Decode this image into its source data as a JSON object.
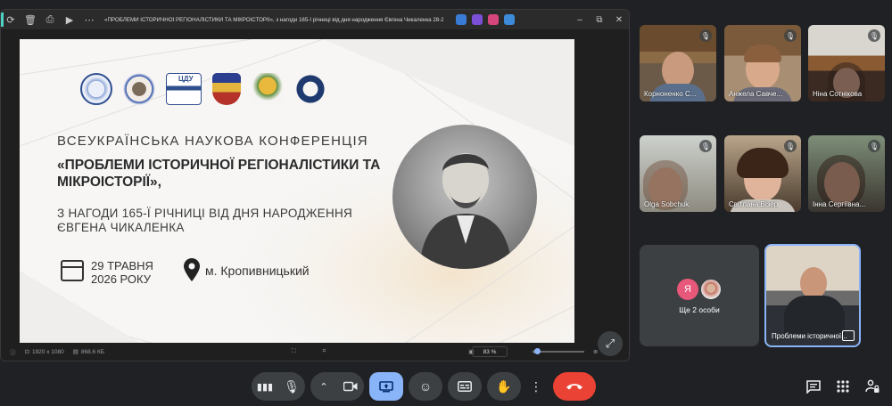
{
  "viewer": {
    "title": "«ПРОБЛЕМИ ІСТОРИЧНОЇ РЕГІОНАЛІСТИКИ ТА МІКРОІСТОРІЇ», з нагоди 165-ї річниці від дня народження Євгена Чикаленка 28-29 трав...",
    "status_dimensions": "1920 x 1080",
    "status_size": "868.6 КБ",
    "zoom": "83 %"
  },
  "slide": {
    "logo_label": "ЦДУ",
    "heading": "ВСЕУКРАЇНСЬКА НАУКОВА КОНФЕРЕНЦІЯ",
    "title": "«ПРОБЛЕМИ ІСТОРИЧНОЇ РЕГІОНАЛІСТИКИ ТА МІКРОІСТОРІЇ»,",
    "subtitle": "З НАГОДИ 165-Ї РІЧНИЦІ ВІД ДНЯ НАРОДЖЕННЯ ЄВГЕНА ЧИКАЛЕНКА",
    "date_line1": "29 ТРАВНЯ",
    "date_line2": "2026 РОКУ",
    "city": "м. Кропивницький"
  },
  "participants": [
    {
      "name": "Корноненко С..."
    },
    {
      "name": "Анжела Савче..."
    },
    {
      "name": "Ніна Сотнікова"
    },
    {
      "name": "Olga Sobchuk"
    },
    {
      "name": "Світлана Візер"
    },
    {
      "name": "Інна Сергіївна..."
    }
  ],
  "more_tile": {
    "avatar_letter": "Я",
    "label": "Ще 2 особи"
  },
  "presenter": {
    "name": "Проблеми історичної..."
  },
  "colors": {
    "background": "#202124",
    "accent": "#8ab4f8",
    "end_call": "#ea4335",
    "avatar": "#e8587a"
  }
}
